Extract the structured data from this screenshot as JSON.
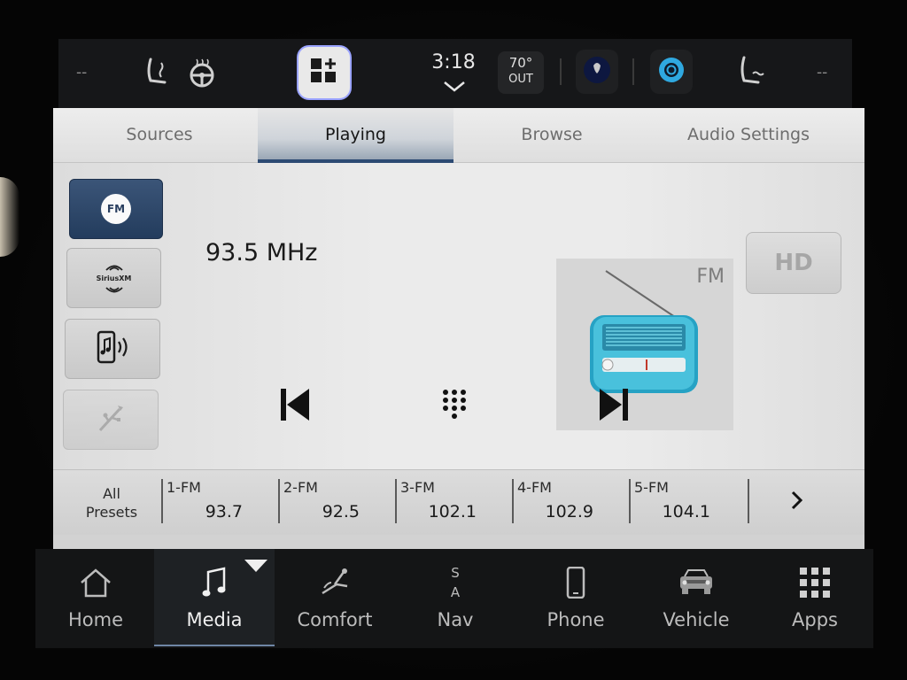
{
  "status_bar": {
    "left_dash": "--",
    "right_dash": "--",
    "time": "3:18",
    "temperature": "70°",
    "temperature_label": "OUT",
    "icons": [
      "heated-seat-icon",
      "heated-steering-icon",
      "app-grid-plus-icon",
      "voice-assistant-icon",
      "alexa-icon",
      "ventilated-seat-icon"
    ]
  },
  "tabs": [
    {
      "label": "Sources"
    },
    {
      "label": "Playing"
    },
    {
      "label": "Browse"
    },
    {
      "label": "Audio Settings"
    }
  ],
  "active_tab": "Playing",
  "sources": {
    "fm_label": "FM",
    "siriusxm_label": "SiriusXM",
    "active": "FM"
  },
  "now_playing": {
    "frequency": "93.5 MHz",
    "art_label": "FM",
    "hd_label": "HD"
  },
  "presets": {
    "all_label_line1": "All",
    "all_label_line2": "Presets",
    "items": [
      {
        "name": "1-FM",
        "freq": "93.7"
      },
      {
        "name": "2-FM",
        "freq": "92.5"
      },
      {
        "name": "3-FM",
        "freq": "102.1"
      },
      {
        "name": "4-FM",
        "freq": "102.9"
      },
      {
        "name": "5-FM",
        "freq": "104.1"
      }
    ]
  },
  "nav": [
    {
      "label": "Home"
    },
    {
      "label": "Media"
    },
    {
      "label": "Comfort"
    },
    {
      "label": "Nav"
    },
    {
      "label": "Phone"
    },
    {
      "label": "Vehicle"
    },
    {
      "label": "Apps"
    }
  ],
  "nav_compass": {
    "top": "S",
    "bottom": "A"
  },
  "active_nav": "Media",
  "colors": {
    "accent_blue": "#2c4a73",
    "radio_teal": "#3fb3cf",
    "bar_dark": "#141516"
  }
}
